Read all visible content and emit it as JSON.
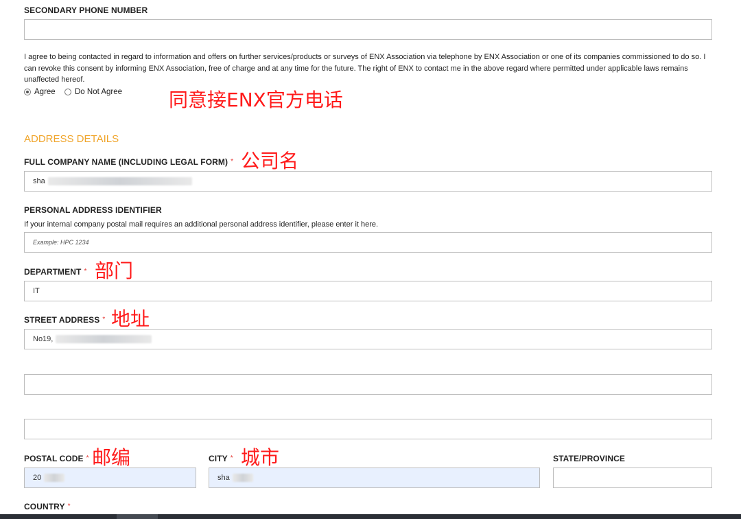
{
  "secondary_phone": {
    "label": "SECONDARY PHONE NUMBER",
    "value": ""
  },
  "consent": {
    "text": "I agree to being contacted in regard to information and offers on further services/products or surveys of ENX Association via telephone by ENX Association or one of its companies commissioned to do so. I can revoke this consent by informing ENX Association, free of charge and at any time for the future. The right of ENX to contact me in the above regard where permitted under applicable laws remains unaffected hereof.",
    "agree_label": "Agree",
    "disagree_label": "Do Not Agree",
    "selected": "Agree"
  },
  "address": {
    "section_title": "ADDRESS DETAILS",
    "required_mark": "*",
    "company": {
      "label": "FULL COMPANY NAME (INCLUDING LEGAL FORM)",
      "value": "sha"
    },
    "personal_id": {
      "label": "PERSONAL ADDRESS IDENTIFIER",
      "help": "If your internal company postal mail requires an additional personal address identifier, please enter it here.",
      "placeholder": "Example: HPC 1234"
    },
    "department": {
      "label": "DEPARTMENT",
      "value": "IT"
    },
    "street": {
      "label": "STREET ADDRESS",
      "value": "No19, ",
      "line2": "",
      "line3": ""
    },
    "postal": {
      "label": "POSTAL CODE",
      "value": "20"
    },
    "city": {
      "label": "CITY",
      "value": "sha"
    },
    "state": {
      "label": "STATE/PROVINCE",
      "value": ""
    },
    "country": {
      "label": "COUNTRY"
    }
  },
  "annotations": {
    "phone": "同意接ENX官方电话",
    "company": "公司名",
    "department": "部门",
    "street": "地址",
    "postal": "邮编",
    "city": "城市"
  },
  "colors": {
    "section": "#f0a52b",
    "required": "#e53935",
    "annotation": "#ff1a1a",
    "autofill": "#e8f0fe"
  }
}
